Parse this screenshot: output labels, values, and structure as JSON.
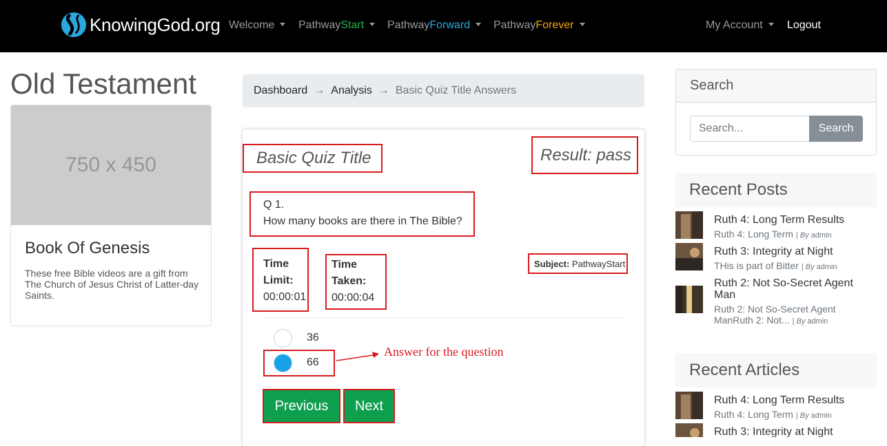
{
  "nav": {
    "brand": "KnowingGod.org",
    "welcome": "Welcome",
    "pathway_prefix": "Pathway",
    "start": "Start",
    "forward": "Forward",
    "forever": "Forever",
    "my_account": "My Account",
    "logout": "Logout"
  },
  "left": {
    "heading": "Old Testament",
    "image_placeholder": "750 x 450",
    "card_title": "Book Of Genesis",
    "card_text": "These free Bible videos are a gift from The Church of Jesus Christ of Latter-day Saints."
  },
  "breadcrumb": {
    "items": [
      "Dashboard",
      "Analysis"
    ],
    "separator": "→",
    "active": "Basic Quiz Title Answers"
  },
  "quiz": {
    "title": "Basic Quiz Title",
    "result": "Result: pass",
    "question_number": "Q 1.",
    "question_text": "How many books are there in The Bible?",
    "time_limit_label_1": "Time",
    "time_limit_label_2": "Limit:",
    "time_limit_value": "00:00:01",
    "time_taken_label_1": "Time",
    "time_taken_label_2": "Taken:",
    "time_taken_value": "00:00:04",
    "subject_label": "Subject:",
    "subject_value": "PathwayStart",
    "options": [
      "36",
      "66"
    ],
    "selected_option": "66",
    "annotation": "Answer for the question",
    "previous_label": "Previous",
    "next_label": "Next"
  },
  "sidebar": {
    "search_title": "Search",
    "search_placeholder": "Search...",
    "search_button": "Search",
    "recent_posts_title": "Recent Posts",
    "recent_posts": [
      {
        "title": "Ruth 4: Long Term Results",
        "excerpt": "Ruth 4: Long Term",
        "by": "By",
        "author": "admin"
      },
      {
        "title": "Ruth 3: Integrity at Night",
        "excerpt": "THis is part of Bitter",
        "by": "By",
        "author": "admin"
      },
      {
        "title": "Ruth 2: Not So-Secret Agent Man",
        "excerpt": "Ruth 2: Not So-Secret Agent ManRuth 2: Not...",
        "by": "By",
        "author": "admin"
      }
    ],
    "recent_articles_title": "Recent Articles",
    "recent_articles": [
      {
        "title": "Ruth 4: Long Term Results",
        "excerpt": "Ruth 4: Long Term",
        "by": "By",
        "author": "admin"
      },
      {
        "title": "Ruth 3: Integrity at Night"
      }
    ]
  },
  "colors": {
    "navbar": "#000000",
    "pathway_start": "#22b24c",
    "pathway_forward": "#2aa7e0",
    "pathway_forever": "#f5a40c",
    "button_green": "#0e9f4f",
    "annotation_red": "#d9191e",
    "radio_selected": "#17a2e8"
  }
}
